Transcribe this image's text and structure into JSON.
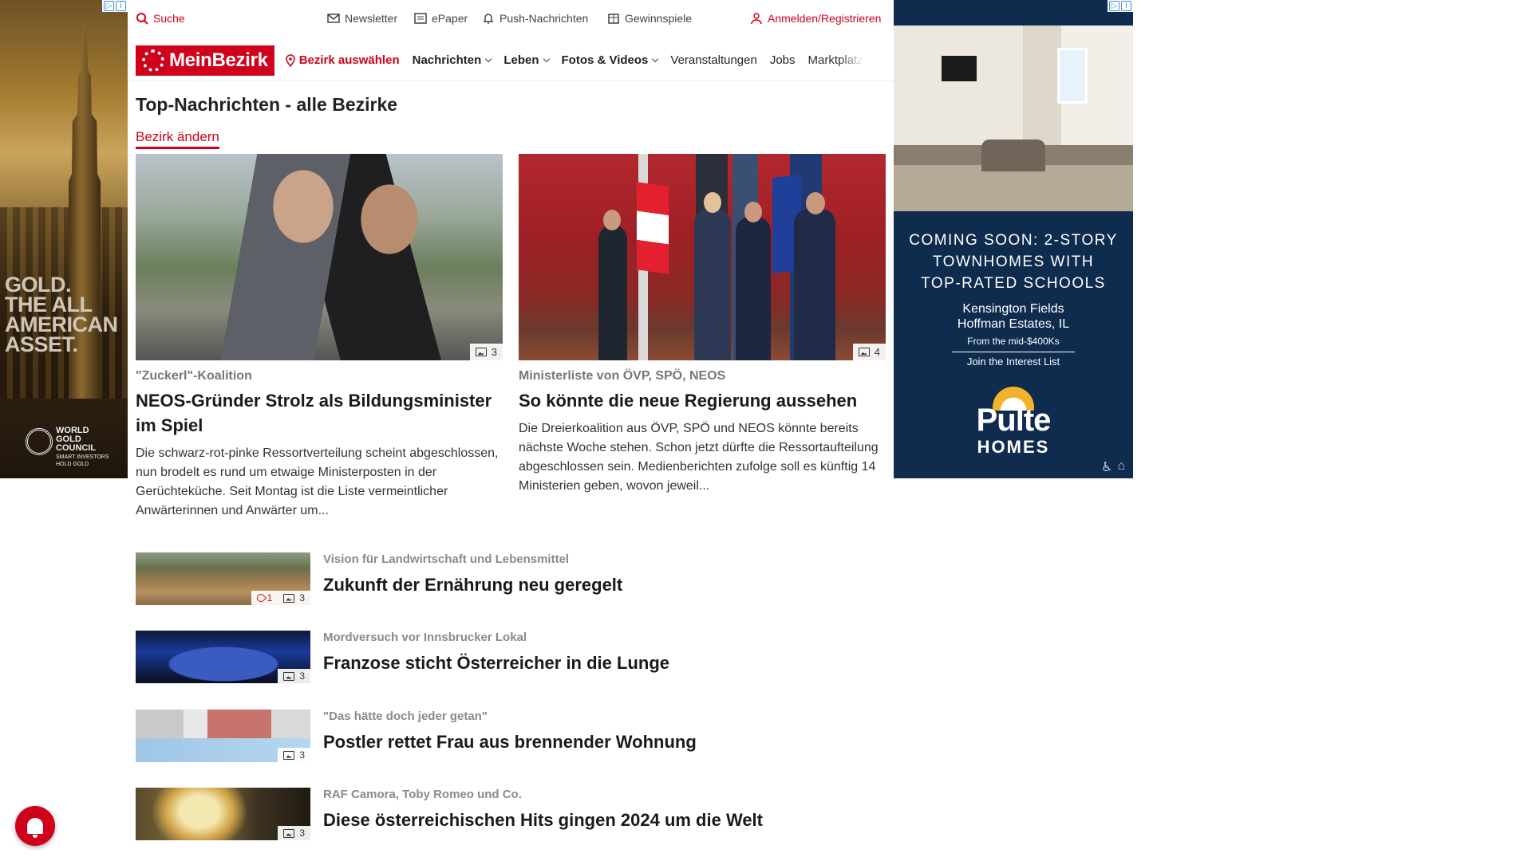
{
  "topbar": {
    "search_label": "Suche",
    "newsletter_label": "Newsletter",
    "epaper_label": "ePaper",
    "push_label": "Push-Nachrichten",
    "gewinnspiele_label": "Gewinnspiele",
    "login_label": "Anmelden/Registrieren"
  },
  "nav": {
    "logo_text": "MeinBezirk",
    "select_district": "Bezirk auswählen",
    "items": [
      {
        "label": "Nachrichten"
      },
      {
        "label": "Leben"
      },
      {
        "label": "Fotos & Videos"
      },
      {
        "label": "Veranstaltungen"
      },
      {
        "label": "Jobs"
      },
      {
        "label": "Marktplatz"
      }
    ]
  },
  "main": {
    "title": "Top-Nachrichten - alle Bezirke",
    "change_district": "Bezirk ändern",
    "featured": [
      {
        "kicker": "\"Zuckerl\"-Koalition",
        "headline": "NEOS-Gründer Strolz als Bildungsminister im Spiel",
        "teaser": "Die schwarz-rot-pinke Ressortverteilung scheint abgeschlossen, nun brodelt es rund um etwaige Ministerposten in der Gerüchteküche. Seit Montag ist die Liste vermeintlicher Anwärterinnen und Anwärter um...",
        "gallery_count": "3"
      },
      {
        "kicker": "Ministerliste von ÖVP, SPÖ, NEOS",
        "headline": "So könnte die neue Regierung aussehen",
        "teaser": "Die Dreierkoalition aus ÖVP, SPÖ und NEOS könnte bereits nächste Woche stehen. Schon jetzt dürfte die Ressortaufteilung abgeschlossen sein. Medienberichten zufolge soll es künftig 14 Ministerien geben, wovon jeweil...",
        "gallery_count": "4"
      }
    ],
    "list": [
      {
        "kicker": "Vision für Landwirtschaft und Lebensmittel",
        "headline": "Zukunft der Ernährung neu geregelt",
        "likes": "1",
        "gallery_count": "3"
      },
      {
        "kicker": "Mordversuch vor Innsbrucker Lokal",
        "headline": "Franzose sticht Österreicher in die Lunge",
        "gallery_count": "3"
      },
      {
        "kicker": "\"Das hätte doch jeder getan\"",
        "headline": "Postler rettet Frau aus brennender Wohnung",
        "gallery_count": "3"
      },
      {
        "kicker": "RAF Camora, Toby Romeo und Co.",
        "headline": "Diese österreichischen Hits gingen 2024 um die Welt",
        "gallery_count": "3"
      }
    ]
  },
  "ads": {
    "left": {
      "slogan": [
        "GOLD.",
        "THE ALL",
        "AMERICAN",
        "ASSET."
      ],
      "org": [
        "WORLD",
        "GOLD",
        "COUNCIL"
      ],
      "tagline": [
        "SMART INVESTORS",
        "HOLD GOLD"
      ]
    },
    "right": {
      "headline": [
        "COMING SOON: 2-STORY",
        "TOWNHOMES WITH",
        "TOP-RATED SCHOOLS"
      ],
      "location": [
        "Kensington Fields",
        "Hoffman Estates, IL"
      ],
      "price": "From the mid-$400Ks",
      "cta": "Join the Interest List",
      "brand": "Pulte",
      "brand_sub": "HOMES"
    }
  },
  "colors": {
    "brand_red": "#d0021b",
    "ad_navy": "#0f2c4e"
  },
  "icons": {
    "search": "search-icon",
    "newsletter": "mail-icon",
    "epaper": "newspaper-icon",
    "push": "bell-icon",
    "gewinnspiele": "gift-icon",
    "login": "user-icon",
    "location": "map-pin-icon",
    "gallery": "image-gallery-icon",
    "like": "heart-icon"
  }
}
